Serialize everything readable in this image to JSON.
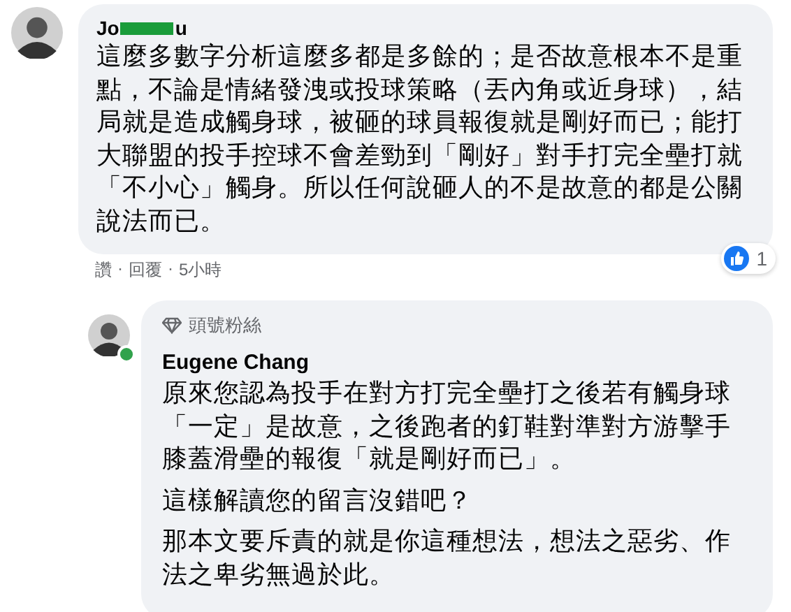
{
  "comment": {
    "author_start": "Jo",
    "author_end": "u",
    "text": "這麼多數字分析這麼多都是多餘的；是否故意根本不是重點，不論是情緒發洩或投球策略（丟內角或近身球），結局就是造成觸身球，被砸的球員報復就是剛好而已；能打大聯盟的投手控球不會差勁到「剛好」對手打完全壘打就「不小心」觸身。所以任何說砸人的不是故意的都是公關說法而已。",
    "actions": [
      "讚",
      "回覆",
      "5小時"
    ],
    "separator": "·",
    "reaction_count": "1"
  },
  "reply": {
    "badge": "頭號粉絲",
    "author": "Eugene Chang",
    "online": true,
    "paragraphs": [
      "原來您認為投手在對方打完全壘打之後若有觸身球「一定」是故意，之後跑者的釘鞋對準對方游擊手膝蓋滑壘的報復「就是剛好而已」。",
      "這樣解讀您的留言沒錯吧？",
      "那本文要斥責的就是你這種想法，想法之惡劣、作法之卑劣無過於此。"
    ]
  }
}
